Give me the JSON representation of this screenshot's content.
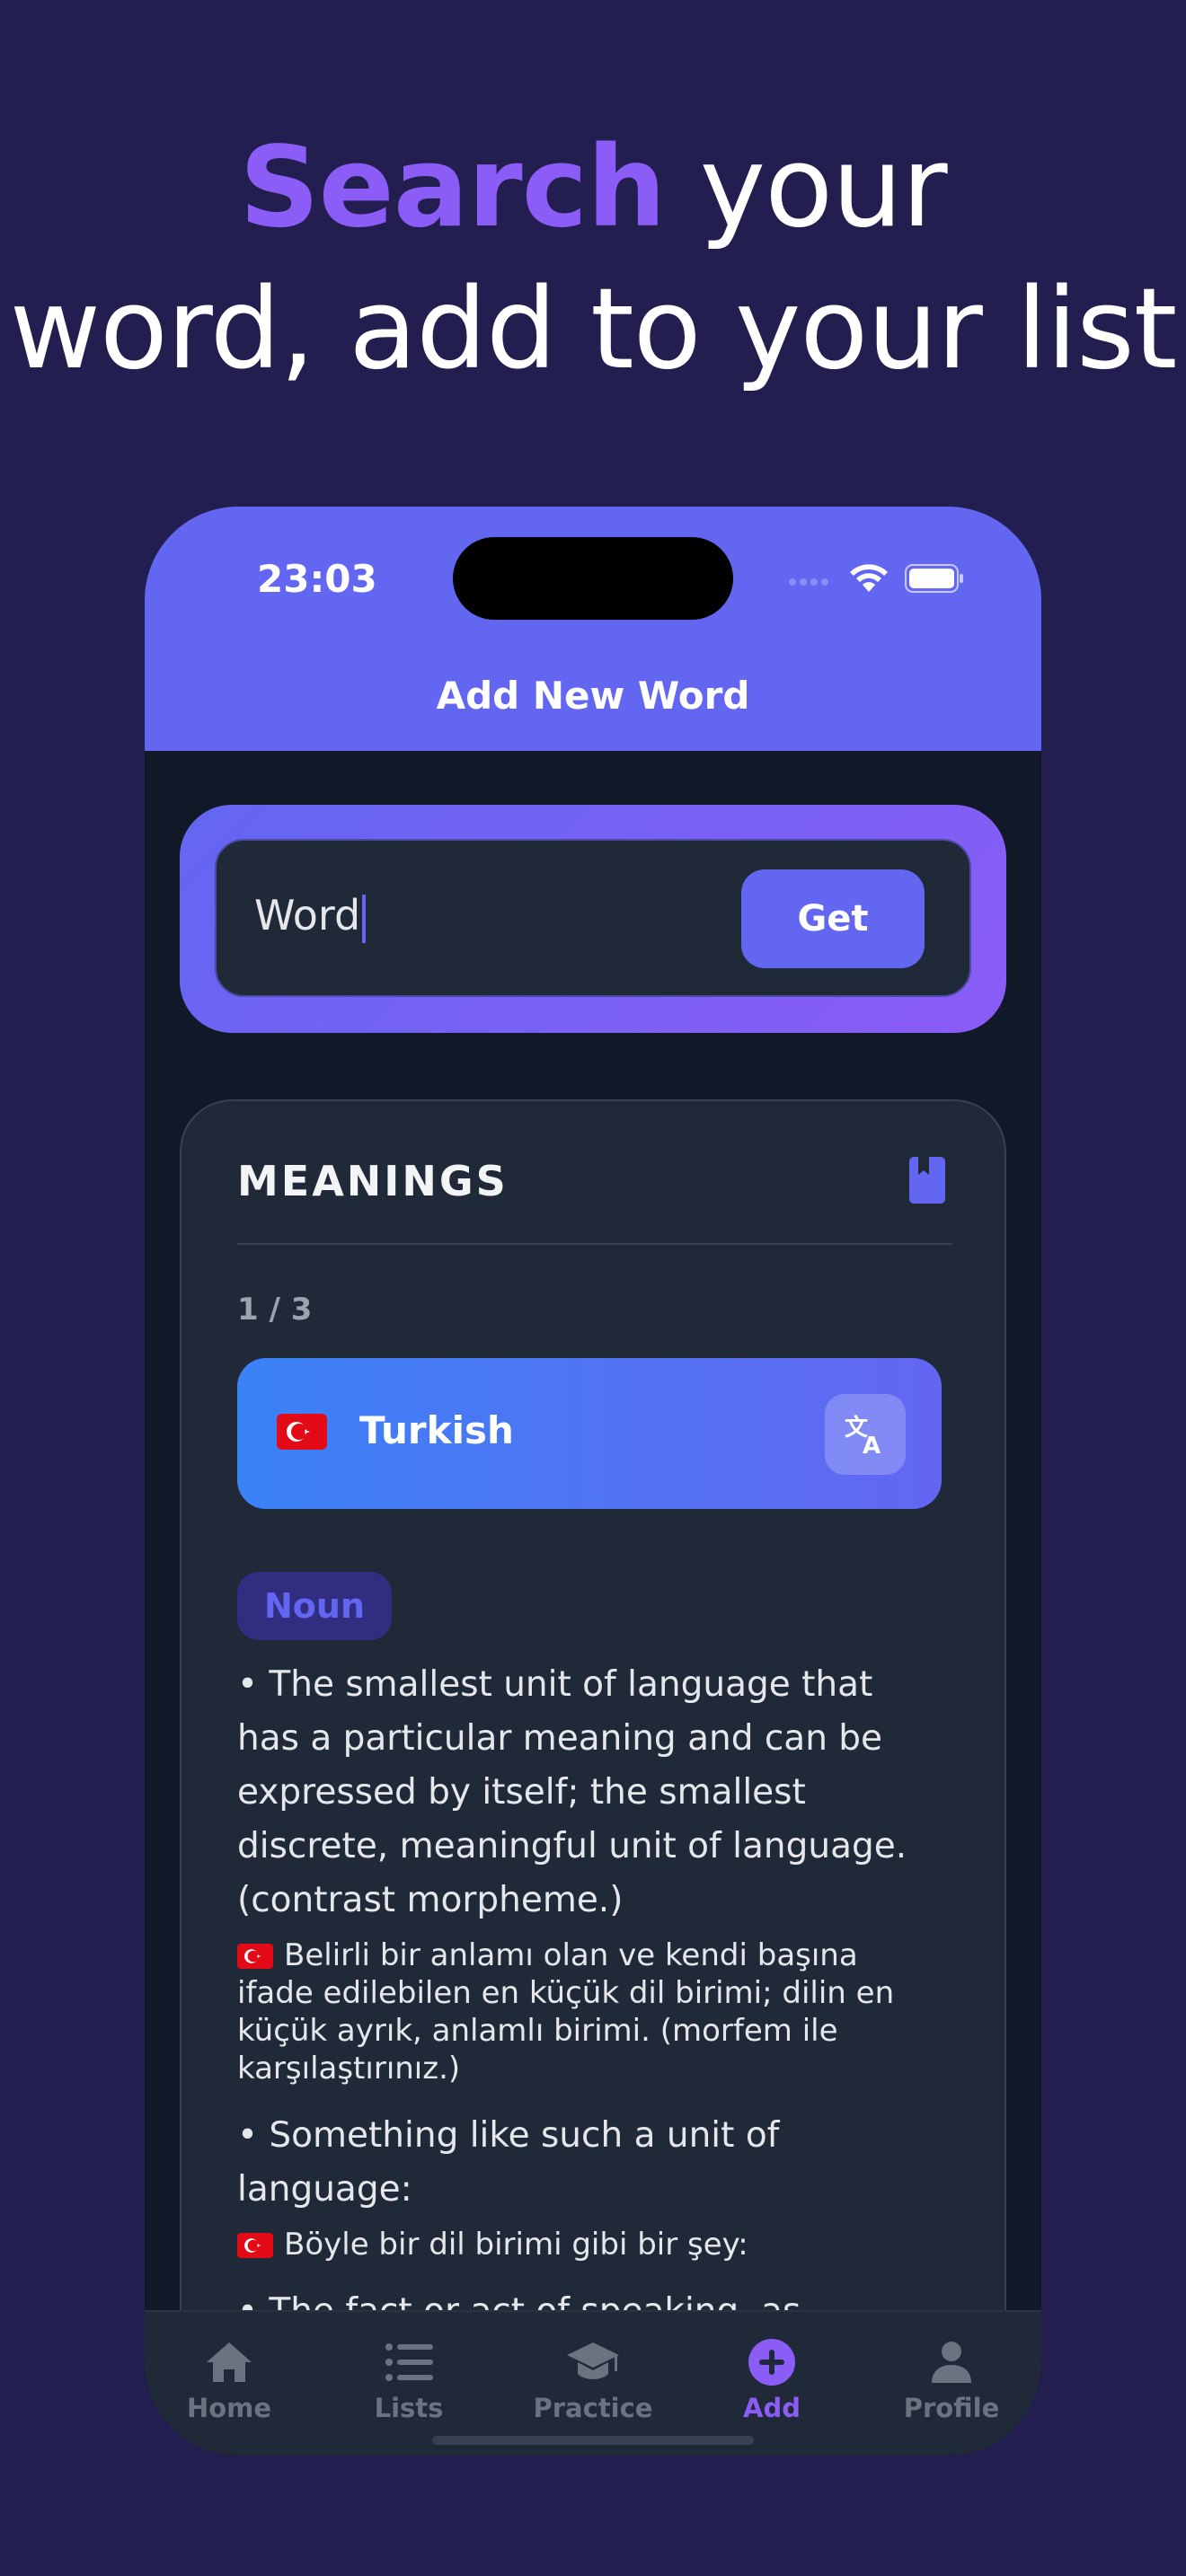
{
  "headline": {
    "accent": "Search",
    "rest_line1": " your",
    "line2": "word, add to your list"
  },
  "status_bar": {
    "time": "23:03"
  },
  "header": {
    "title": "Add New Word"
  },
  "search": {
    "value": "Word",
    "button_label": "Get"
  },
  "meanings": {
    "title": "MEANINGS",
    "counter": "1 / 3",
    "language": "Turkish",
    "part_of_speech": "Noun",
    "definitions": [
      {
        "en": "• The smallest unit of language that has a particular meaning and can be expressed by itself; the smallest discrete, meaningful unit of language. (contrast morpheme.)",
        "tr": "Belirli bir anlamı olan ve kendi başına ifade edilebilen en küçük dil birimi; dilin en küçük ayrık, anlamlı birimi. (morfem ile karşılaştırınız.)"
      },
      {
        "en": "• Something like such a unit of language:",
        "tr": "Böyle bir dil birimi gibi bir şey:"
      },
      {
        "en": "• The fact or act of speaking, as opposed to taking action.",
        "tr": ""
      }
    ]
  },
  "tabs": [
    {
      "label": "Home",
      "icon": "house-icon",
      "active": false
    },
    {
      "label": "Lists",
      "icon": "list-icon",
      "active": false
    },
    {
      "label": "Practice",
      "icon": "graduation-cap-icon",
      "active": false
    },
    {
      "label": "Add",
      "icon": "plus-circle-icon",
      "active": true
    },
    {
      "label": "Profile",
      "icon": "person-icon",
      "active": false
    }
  ],
  "colors": {
    "background": "#221e50",
    "accent_purple": "#8b5cf6",
    "header_indigo": "#6366f1",
    "card": "#1f2937"
  }
}
